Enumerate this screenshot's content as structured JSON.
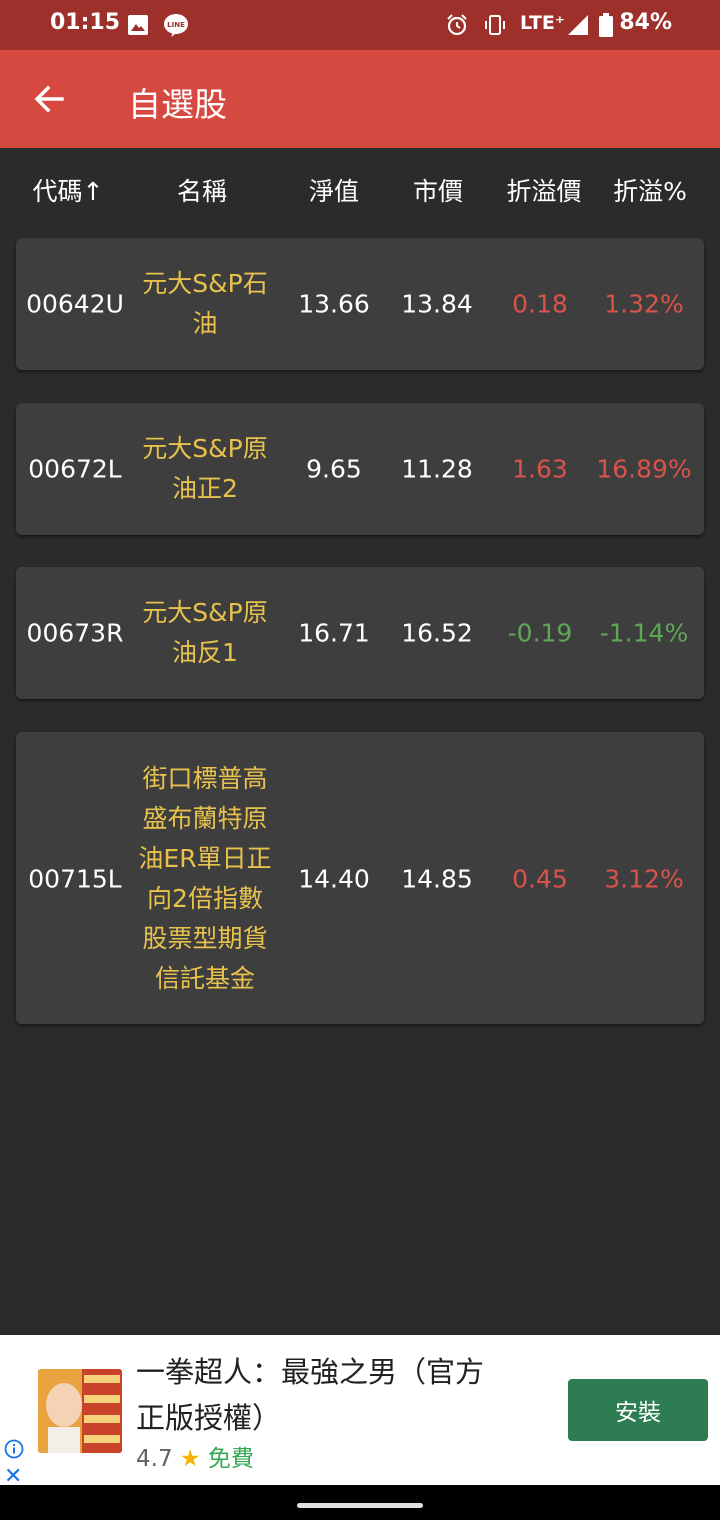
{
  "status_bar": {
    "time": "01:15",
    "network": "LTE⁺",
    "battery": "84%",
    "icons": [
      "image-icon",
      "line-icon",
      "alarm-icon",
      "vibrate-icon",
      "signal-icon",
      "battery-icon"
    ]
  },
  "app_bar": {
    "title": "自選股",
    "back_icon": "arrow-left-icon",
    "color": "#d64941"
  },
  "table": {
    "headers": {
      "code": "代碼↑",
      "name": "名稱",
      "nav": "淨值",
      "price": "市價",
      "diff": "折溢價",
      "pct": "折溢%"
    },
    "rows": [
      {
        "code": "00642U",
        "name_lines": [
          "元大S&P石",
          "油"
        ],
        "nav": "13.66",
        "price": "13.84",
        "diff": "0.18",
        "pct": "1.32%",
        "trend": "up"
      },
      {
        "code": "00672L",
        "name_lines": [
          "元大S&P原",
          "油正2"
        ],
        "nav": "9.65",
        "price": "11.28",
        "diff": "1.63",
        "pct": "16.89%",
        "trend": "up"
      },
      {
        "code": "00673R",
        "name_lines": [
          "元大S&P原",
          "油反1"
        ],
        "nav": "16.71",
        "price": "16.52",
        "diff": "-0.19",
        "pct": "-1.14%",
        "trend": "down"
      },
      {
        "code": "00715L",
        "name_lines": [
          "街口標普高",
          "盛布蘭特原",
          "油ER單日正",
          "向2倍指數",
          "股票型期貨",
          "信託基金"
        ],
        "nav": "14.40",
        "price": "14.85",
        "diff": "0.45",
        "pct": "3.12%",
        "trend": "up"
      }
    ],
    "colors": {
      "up": "#d9534a",
      "down": "#5fa757",
      "name": "#e8c24d"
    }
  },
  "ad": {
    "title_lines": [
      "一拳超人：最強之男（官方",
      "正版授權）"
    ],
    "rating": "4.7",
    "star": "★",
    "price": "免費",
    "install_label": "安裝",
    "close_glyph": "✕"
  }
}
